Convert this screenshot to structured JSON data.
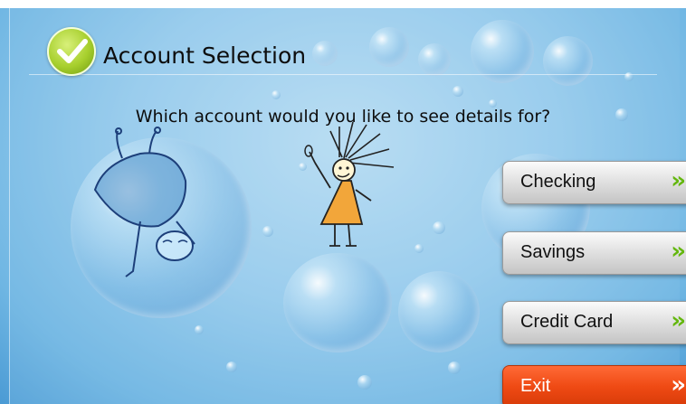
{
  "screen": {
    "title": "Account Selection",
    "question": "Which account would you like to see details for?"
  },
  "buttons": [
    {
      "label": "Checking",
      "icon": "double-chevron-right-icon",
      "arrow": "»"
    },
    {
      "label": "Savings",
      "icon": "double-chevron-right-icon",
      "arrow": "»"
    },
    {
      "label": "Credit Card",
      "icon": "double-chevron-right-icon",
      "arrow": "»"
    },
    {
      "label": "Exit",
      "icon": "double-chevron-right-icon",
      "arrow": "»"
    }
  ],
  "colors": {
    "background": "#9fd0ef",
    "title_check": "#a7cf2d",
    "arrow_green": "#63b70d",
    "exit_red": "#ef4a14"
  }
}
